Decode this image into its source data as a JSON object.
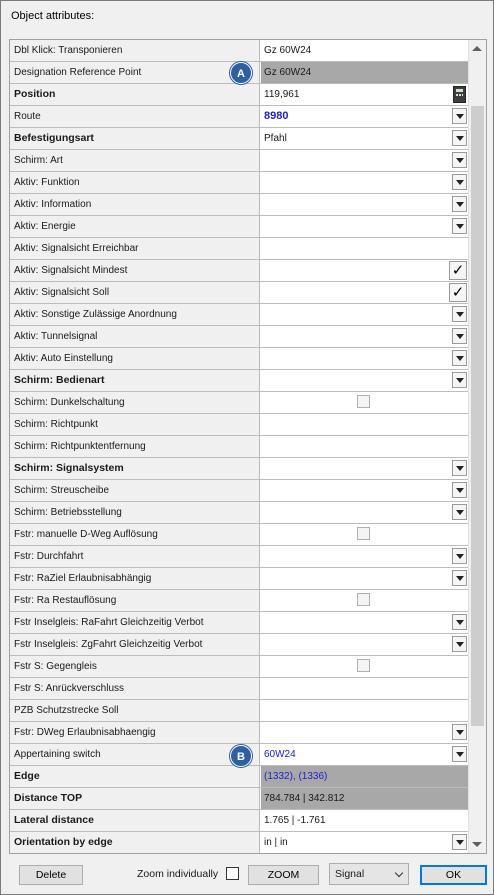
{
  "window": {
    "title": "Object attributes:"
  },
  "grid": {
    "rows": [
      {
        "label": "Dbl Klick: Transponieren",
        "bold": false,
        "value": "Gz 60W24",
        "style": "",
        "control": ""
      },
      {
        "label": "Designation Reference Point",
        "bold": false,
        "value": "Gz 60W24",
        "style": "grey",
        "control": ""
      },
      {
        "label": "Position",
        "bold": true,
        "value": "119,961",
        "style": "",
        "control": "calc"
      },
      {
        "label": "Route",
        "bold": false,
        "value": "8980",
        "style": "bluebold",
        "control": "dropdown"
      },
      {
        "label": "Befestigungsart",
        "bold": true,
        "value": "Pfahl",
        "style": "",
        "control": "dropdown"
      },
      {
        "label": "Schirm: Art",
        "bold": false,
        "value": "",
        "style": "",
        "control": "dropdown"
      },
      {
        "label": "Aktiv: Funktion",
        "bold": false,
        "value": "",
        "style": "",
        "control": "dropdown"
      },
      {
        "label": "Aktiv: Information",
        "bold": false,
        "value": "",
        "style": "",
        "control": "dropdown"
      },
      {
        "label": "Aktiv: Energie",
        "bold": false,
        "value": "",
        "style": "",
        "control": "dropdown"
      },
      {
        "label": "Aktiv: Signalsicht Erreichbar",
        "bold": false,
        "value": "",
        "style": "",
        "control": ""
      },
      {
        "label": "Aktiv: Signalsicht Mindest",
        "bold": false,
        "value": "",
        "style": "",
        "control": "check"
      },
      {
        "label": "Aktiv: Signalsicht Soll",
        "bold": false,
        "value": "",
        "style": "",
        "control": "check"
      },
      {
        "label": "Aktiv: Sonstige Zulässige Anordnung",
        "bold": false,
        "value": "",
        "style": "",
        "control": "dropdown"
      },
      {
        "label": "Aktiv: Tunnelsignal",
        "bold": false,
        "value": "",
        "style": "",
        "control": "dropdown"
      },
      {
        "label": "Aktiv: Auto Einstellung",
        "bold": false,
        "value": "",
        "style": "",
        "control": "dropdown"
      },
      {
        "label": "Schirm: Bedienart",
        "bold": true,
        "value": "",
        "style": "",
        "control": "dropdown"
      },
      {
        "label": "Schirm: Dunkelschaltung",
        "bold": false,
        "value": "",
        "style": "",
        "control": "checkbox"
      },
      {
        "label": "Schirm: Richtpunkt",
        "bold": false,
        "value": "",
        "style": "",
        "control": ""
      },
      {
        "label": "Schirm: Richtpunktentfernung",
        "bold": false,
        "value": "",
        "style": "",
        "control": ""
      },
      {
        "label": "Schirm: Signalsystem",
        "bold": true,
        "value": "",
        "style": "",
        "control": "dropdown"
      },
      {
        "label": "Schirm: Streuscheibe",
        "bold": false,
        "value": "",
        "style": "",
        "control": "dropdown"
      },
      {
        "label": "Schirm: Betriebsstellung",
        "bold": false,
        "value": "",
        "style": "",
        "control": "dropdown"
      },
      {
        "label": "Fstr: manuelle D-Weg Auflösung",
        "bold": false,
        "value": "",
        "style": "",
        "control": "checkbox"
      },
      {
        "label": "Fstr: Durchfahrt",
        "bold": false,
        "value": "",
        "style": "",
        "control": "dropdown"
      },
      {
        "label": "Fstr: RaZiel Erlaubnisabhängig",
        "bold": false,
        "value": "",
        "style": "",
        "control": "dropdown"
      },
      {
        "label": "Fstr: Ra Restauflösung",
        "bold": false,
        "value": "",
        "style": "",
        "control": "checkbox"
      },
      {
        "label": "Fstr Inselgleis: RaFahrt Gleichzeitig Verbot",
        "bold": false,
        "value": "",
        "style": "",
        "control": "dropdown"
      },
      {
        "label": "Fstr Inselgleis: ZgFahrt Gleichzeitig Verbot",
        "bold": false,
        "value": "",
        "style": "",
        "control": "dropdown"
      },
      {
        "label": "Fstr S: Gegengleis",
        "bold": false,
        "value": "",
        "style": "",
        "control": "checkbox"
      },
      {
        "label": "Fstr S: Anrückverschluss",
        "bold": false,
        "value": "",
        "style": "",
        "control": ""
      },
      {
        "label": "PZB Schutzstrecke Soll",
        "bold": false,
        "value": "",
        "style": "",
        "control": ""
      },
      {
        "label": "Fstr: DWeg Erlaubnisabhaengig",
        "bold": false,
        "value": "",
        "style": "",
        "control": "dropdown"
      },
      {
        "label": "Appertaining switch",
        "bold": false,
        "value": "60W24",
        "style": "blue",
        "control": "dropdown"
      },
      {
        "label": "Edge",
        "bold": true,
        "value": "(1332), (1336)",
        "style": "grey-blue",
        "control": ""
      },
      {
        "label": "Distance TOP",
        "bold": true,
        "value": "784.784 | 342.812",
        "style": "grey",
        "control": ""
      },
      {
        "label": "Lateral distance",
        "bold": true,
        "value": "1.765 | -1.761",
        "style": "",
        "control": ""
      },
      {
        "label": "Orientation by edge",
        "bold": true,
        "value": "in | in",
        "style": "",
        "control": "dropdown"
      }
    ]
  },
  "badges": {
    "a": "A",
    "b": "B"
  },
  "footer": {
    "delete_label": "Delete",
    "zoom_individually_label": "Zoom individually",
    "zoom_label": "ZOOM",
    "type_select_value": "Signal",
    "ok_label": "OK"
  }
}
